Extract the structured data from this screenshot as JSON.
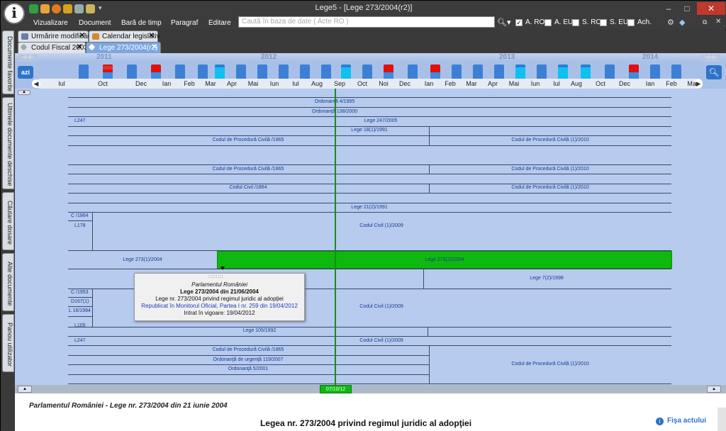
{
  "window": {
    "title": "Lege5 - [Lege 273/2004(r2)]"
  },
  "menu": [
    "Vizualizare",
    "Document",
    "Bară de timp",
    "Paragraf",
    "Editare"
  ],
  "search": {
    "placeholder": "Caută în baza de date ( Acte RO )"
  },
  "filters": [
    {
      "label": "A. RO",
      "checked": true
    },
    {
      "label": "A. EU",
      "checked": false
    },
    {
      "label": "S. RO",
      "checked": false
    },
    {
      "label": "S. EU",
      "checked": false
    },
    {
      "label": "Ach.",
      "checked": false
    }
  ],
  "side_tabs": [
    "Documente favorite",
    "Ultimele documente deschise",
    "Căutare dosare",
    "Alte documente",
    "Panou utilizator"
  ],
  "tabs_row1": [
    {
      "label": "Urmărire modificări"
    },
    {
      "label": "Calendar legislativ"
    }
  ],
  "tabs_row2": [
    {
      "label": "Codul Fiscal 2003"
    },
    {
      "label": "Lege 273/2004(r2)"
    }
  ],
  "timeline": {
    "years": [
      "2011",
      "2012",
      "2013",
      "2014"
    ],
    "left_placeholder": "--/--/--",
    "right_placeholder": "--/--/--",
    "today_label": "azi",
    "months": [
      "Iul",
      "Oct",
      "Dec",
      "Ian",
      "Feb",
      "Mar",
      "Apr",
      "Mai",
      "Iun",
      "Iul",
      "Aug",
      "Sep",
      "Oct",
      "Noi",
      "Dec",
      "Ian",
      "Feb",
      "Mar",
      "Apr",
      "Mai",
      "Iun",
      "Iul",
      "Aug",
      "Oct",
      "Dec",
      "Ian",
      "Feb",
      "Mar"
    ]
  },
  "rows": {
    "r1": "Ordonanţă 4/1995",
    "r2": "Ordonanţă 138/2000",
    "r3l": "L247",
    "r3": "Lege 247/2005",
    "r4": "Lege 18(1)/1991",
    "r5a": "Codul de Procedură Civilă /1865",
    "r5b": "Codul de Procedură Civilă (1)/2010",
    "r6a": "Codul de Procedură Civilă /1865",
    "r6b": "Codul de Procedură Civilă (1)/2010",
    "r7a": "Codul Civil /1864",
    "r7b": "Codul de Procedură Civilă (1)/2010",
    "r8": "Lege 21(2)/1991",
    "r9a": "C /1864",
    "r9b": "L178",
    "r9c": "Codul Civil (1)/2009",
    "r10a": "Lege 273(1)/2004",
    "r10b": "Lege 273(2)/2004",
    "r11": "Lege 7(2)/1998",
    "r12a": "C /1953",
    "r12b": "D167(1)",
    "r12c": "L 16/1994",
    "r12d": "Codul Civil (1)/2009",
    "r13": "L105",
    "r14": "Lege 105/1992",
    "r15a": "L247",
    "r15b": "Codul Civil (1)/2009",
    "r16": "Codul de Procedură Civilă /1865",
    "r17": "Ordonanţă de urgenţă 119/2007",
    "r18": "Ordonanţă 5/2001",
    "r19": "Codul de Procedură Civilă (1)/2010"
  },
  "popup": {
    "issuer": "Parlamentul României",
    "title": "Lege 273/2004 din 21/06/2004",
    "subject": "Lege nr. 273/2004 privind regimul juridic al adopţiei",
    "republished": "Republicat în Monitorul Oficial, Partea I nr. 259 din 19/04/2012",
    "in_force": "Intrat în vigoare: 19/04/2012"
  },
  "scroll": {
    "date": "07/10/12"
  },
  "bottom": {
    "header": "Parlamentul României - Lege nr. 273/2004 din 21 iunie 2004",
    "heading": "Legea nr. 273/2004 privind regimul juridic al adopţiei",
    "fisa": "Fişa actului"
  }
}
